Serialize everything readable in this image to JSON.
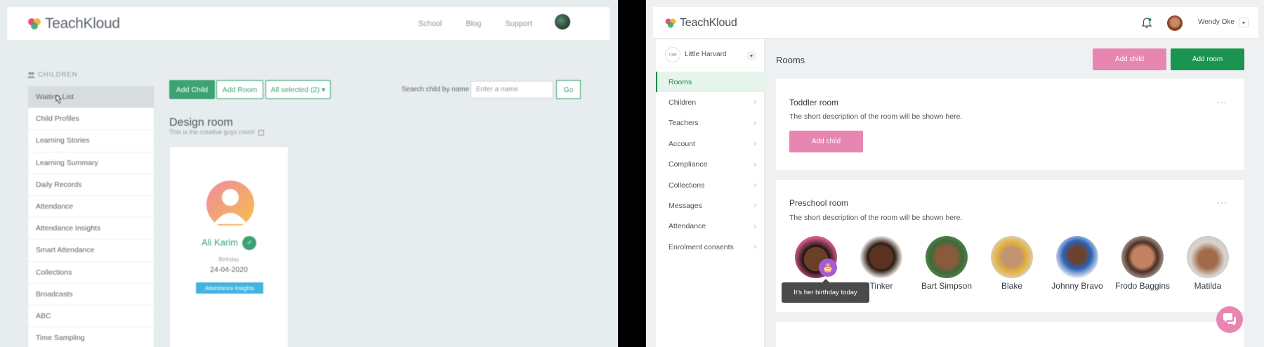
{
  "left": {
    "brand": "TeachKloud",
    "nav": [
      "School",
      "Blog",
      "Support",
      "€"
    ],
    "section_title": "CHILDREN",
    "sidebar": [
      "Waiting List",
      "Child Profiles",
      "Learning Stories",
      "Learning Summary",
      "Daily Records",
      "Attendance",
      "Attendance Insights",
      "Smart Attendance",
      "Collections",
      "Broadcasts",
      "ABC",
      "Time Sampling"
    ],
    "toolbar": {
      "add_child": "Add Child",
      "add_room": "Add Room",
      "all_selected": "All selected (2) ▾",
      "search_label": "Search child by name",
      "search_placeholder": "Enter a name",
      "go": "Go"
    },
    "room": {
      "title": "Design room",
      "description": "This is the creative guys room!"
    },
    "child_card": {
      "name": "Ali Karim",
      "gender_symbol": "♂",
      "birthday_label": "Birthday",
      "birthday": "24-04-2020",
      "badge": "Attendance Insights"
    }
  },
  "right": {
    "brand": "TeachKloud",
    "user_name": "Wendy Oke",
    "school": {
      "logo_text": "Logo",
      "name": "Little Harvard"
    },
    "nav": [
      "Rooms",
      "Children",
      "Teachers",
      "Account",
      "Compliance",
      "Collections",
      "Messages",
      "Attendance",
      "Enrolment consents"
    ],
    "page_title": "Rooms",
    "buttons": {
      "add_child": "Add child",
      "add_room": "Add room"
    },
    "rooms": [
      {
        "title": "Toddler room",
        "description": "The short description of the room will be shown here.",
        "add_child": "Add child"
      },
      {
        "title": "Preschool room",
        "description": "The short description of the room will be shown here.",
        "children": [
          "",
          "Tinker",
          "Bart Simpson",
          "Blake",
          "Johnny Bravo",
          "Frodo Baggins",
          "Matilda"
        ],
        "tooltip": "It's her birthday today"
      }
    ],
    "more_label": "···"
  },
  "colors": {
    "green": "#1b9452",
    "pink": "#e886b2",
    "old_green": "#3ea374",
    "badge_blue": "#43b4e0",
    "cake_purple": "#a35bd6"
  }
}
